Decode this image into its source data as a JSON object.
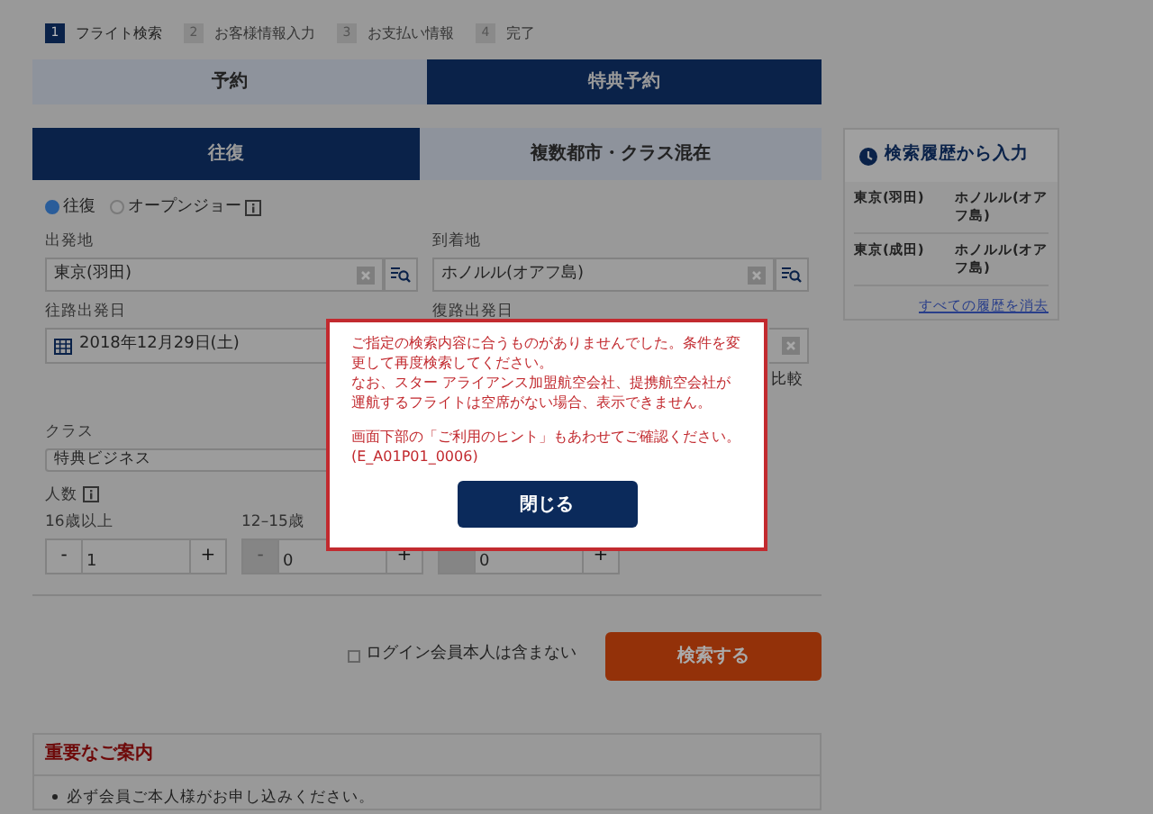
{
  "steps": [
    {
      "number": "1",
      "label": "フライト検索",
      "selected": true
    },
    {
      "number": "2",
      "label": "お客様情報入力",
      "selected": false
    },
    {
      "number": "3",
      "label": "お支払い情報",
      "selected": false
    },
    {
      "number": "4",
      "label": "完了",
      "selected": false
    }
  ],
  "booking_tabs": [
    {
      "label": "予約",
      "selected": false
    },
    {
      "label": "特典予約",
      "selected": true
    }
  ],
  "trip_tabs": [
    {
      "label": "往復",
      "selected": true
    },
    {
      "label": "複数都市・クラス混在",
      "selected": false
    }
  ],
  "trip_radios": [
    {
      "label": "往復",
      "selected": true,
      "info_icon": false
    },
    {
      "label": "オープンジョー",
      "selected": false,
      "info_icon": true
    }
  ],
  "departure": {
    "label": "出発地",
    "value": "東京(羽田)"
  },
  "arrival": {
    "label": "到着地",
    "value": "ホノルル(オアフ島)"
  },
  "outbound_date": {
    "label": "往路出発日",
    "value": "2018年12月29日(土)"
  },
  "return_date": {
    "label": "復路出発日"
  },
  "compare_text": "比較",
  "cabin_class": {
    "label": "クラス",
    "value": "特典ビジネス"
  },
  "passengers": {
    "label": "人数",
    "groups": [
      {
        "label": "16歳以上",
        "value": "1",
        "minus_disabled": false,
        "minus": "-",
        "plus": "+"
      },
      {
        "label": "12–15歳",
        "value": "0",
        "minus_disabled": true,
        "minus": "-",
        "plus": "+"
      },
      {
        "value": "0",
        "minus_disabled": true,
        "plus": "+"
      }
    ]
  },
  "exclude_login": {
    "label": "ログイン会員本人は含まない",
    "checked": false
  },
  "search_button": "検索する",
  "notice": {
    "title": "重要なご案内",
    "items": [
      "必ず会員ご本人様がお申し込みください。"
    ]
  },
  "history": {
    "title": "検索履歴から入力",
    "rows": [
      {
        "from": "東京(羽田)",
        "to": "ホノルル(オアフ島)"
      },
      {
        "from": "東京(成田)",
        "to": "ホノルル(オアフ島)"
      }
    ],
    "clear_link": "すべての履歴を消去"
  },
  "dialog": {
    "paragraphs": [
      [
        "ご指定の検索内容に合うものがありませんでした。条件を変更して再度検索してください。",
        "なお、スター アライアンス加盟航空会社、提携航空会社が運航するフライトは空席がない場合、表示できません。"
      ],
      [
        "画面下部の「ご利用のヒント」もあわせてご確認ください。",
        "(E_A01P01_0006)"
      ]
    ],
    "button": "閉じる"
  }
}
